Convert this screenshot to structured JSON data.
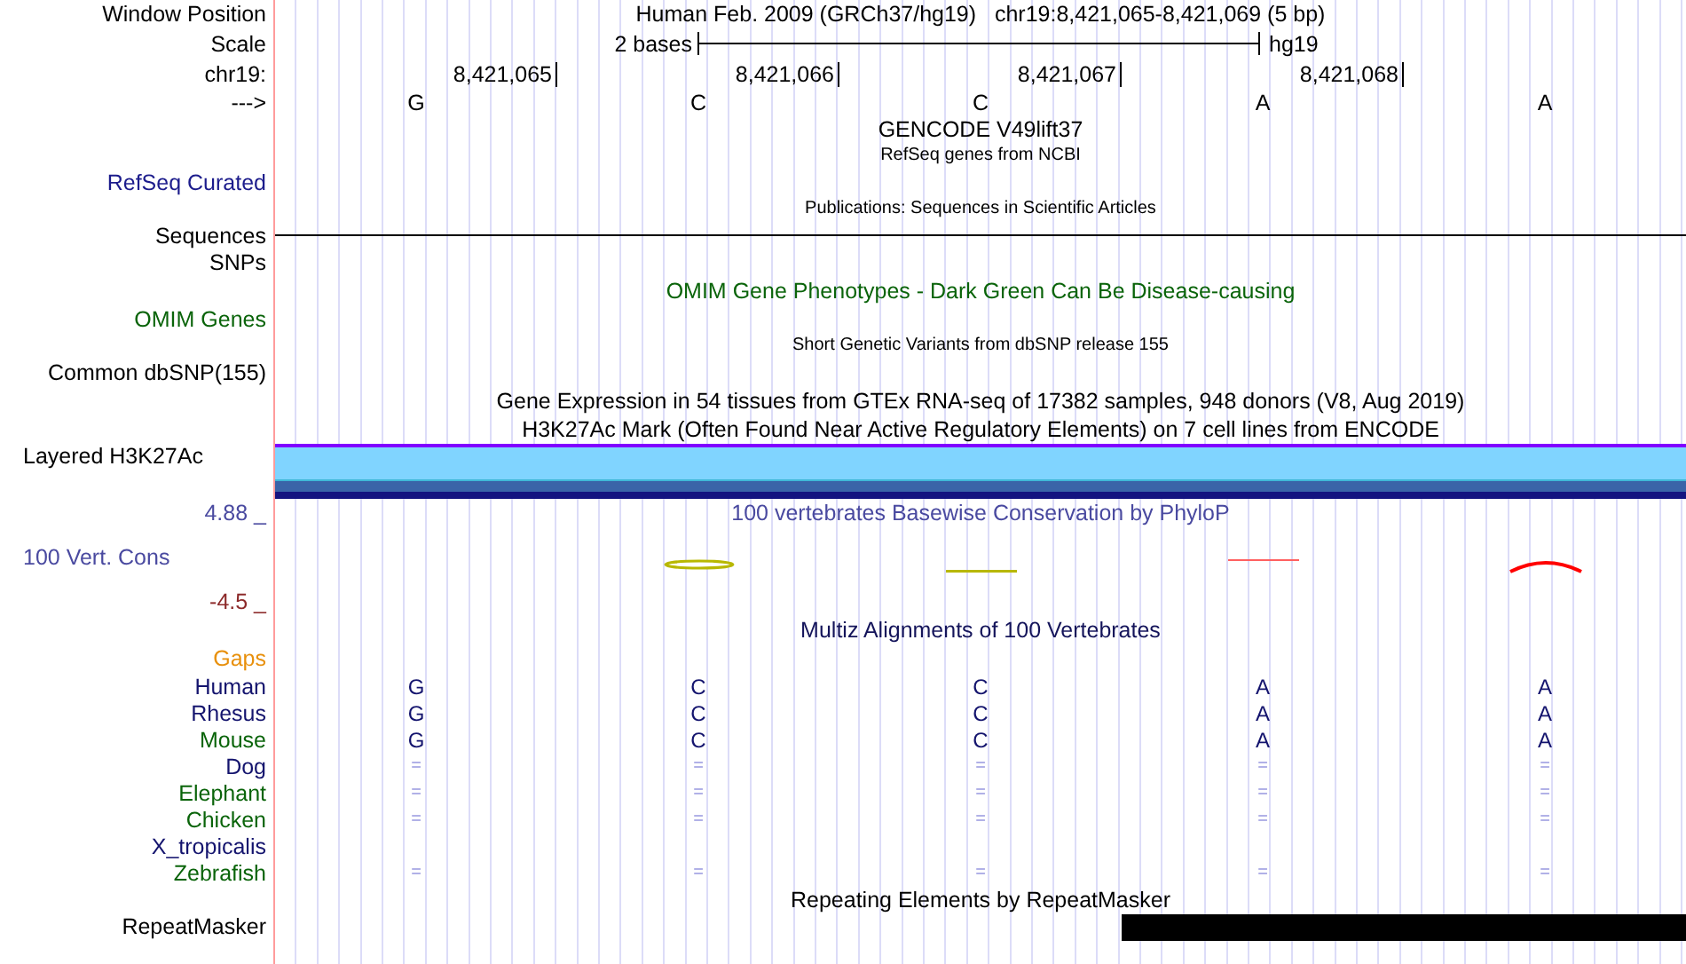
{
  "rows": [
    {
      "kind": "position",
      "label": "Window Position",
      "text": "Human Feb. 2009 (GRCh37/hg19)   chr19:8,421,065-8,421,069 (5 bp)"
    },
    {
      "kind": "scale",
      "label": "Scale",
      "text": "2 bases",
      "assembly": "hg19"
    },
    {
      "kind": "coordinates",
      "label": "chr19:",
      "values": [
        "8,421,065",
        "8,421,066",
        "8,421,067",
        "8,421,068"
      ]
    },
    {
      "kind": "bases",
      "label": "--->",
      "values": [
        "G",
        "C",
        "C",
        "A",
        "A"
      ]
    },
    {
      "kind": "title",
      "title": "GENCODE V49lift37",
      "color": "#000000"
    },
    {
      "kind": "subtitle",
      "title": "RefSeq genes from NCBI"
    },
    {
      "kind": "label",
      "label": "RefSeq Curated",
      "color": "#1c1c8c"
    },
    {
      "kind": "subtitle",
      "title": "Publications: Sequences in Scientific Articles"
    },
    {
      "kind": "line",
      "label": "Sequences",
      "color": "#000000"
    },
    {
      "kind": "label",
      "label": "SNPs",
      "color": "#000000"
    },
    {
      "kind": "title",
      "title": "OMIM Gene Phenotypes - Dark Green Can Be Disease-causing",
      "color": "#0a640a"
    },
    {
      "kind": "label",
      "label": "OMIM Genes",
      "color": "#0a640a"
    },
    {
      "kind": "subtitle",
      "title": "Short Genetic Variants from dbSNP release 155"
    },
    {
      "kind": "label",
      "label": "Common dbSNP(155)",
      "color": "#000000"
    },
    {
      "kind": "title",
      "title": "Gene Expression in 54 tissues from GTEx RNA-seq of 17382 samples, 948 donors (V8, Aug 2019)",
      "color": "#000000"
    },
    {
      "kind": "title",
      "title": "H3K27Ac Mark (Often Found Near Active Regulatory Elements) on 7 cell lines from ENCODE",
      "color": "#000000"
    },
    {
      "kind": "bar",
      "label": "Layered H3K27Ac"
    },
    {
      "kind": "axis",
      "label": "4.88 _",
      "color": "#4a4aa0",
      "title": "100 vertebrates Basewise Conservation by PhyloP"
    },
    {
      "kind": "wiggle",
      "label": "100 Vert. Cons",
      "color": "#4a4aa0"
    },
    {
      "kind": "axis",
      "label": "-4.5 _",
      "color": "#8c2a2a"
    },
    {
      "kind": "title",
      "title": "Multiz Alignments of 100 Vertebrates",
      "color": "#14145a"
    },
    {
      "kind": "label",
      "label": "Gaps",
      "color": "#e8900c"
    },
    {
      "kind": "species",
      "label": "Human",
      "color": "#14146e",
      "aligned": true,
      "values": [
        "G",
        "C",
        "C",
        "A",
        "A"
      ]
    },
    {
      "kind": "species",
      "label": "Rhesus",
      "color": "#14146e",
      "aligned": true,
      "values": [
        "G",
        "C",
        "C",
        "A",
        "A"
      ]
    },
    {
      "kind": "species",
      "label": "Mouse",
      "color": "#0a640a",
      "aligned": true,
      "values": [
        "G",
        "C",
        "C",
        "A",
        "A"
      ]
    },
    {
      "kind": "species",
      "label": "Dog",
      "color": "#14146e",
      "aligned": false,
      "values": [
        "=",
        "=",
        "=",
        "=",
        "="
      ]
    },
    {
      "kind": "species",
      "label": "Elephant",
      "color": "#0a640a",
      "aligned": false,
      "values": [
        "=",
        "=",
        "=",
        "=",
        "="
      ]
    },
    {
      "kind": "species",
      "label": "Chicken",
      "color": "#0a640a",
      "aligned": false,
      "values": [
        "=",
        "=",
        "=",
        "=",
        "="
      ]
    },
    {
      "kind": "species",
      "label": "X_tropicalis",
      "color": "#14146e"
    },
    {
      "kind": "species",
      "label": "Zebrafish",
      "color": "#0a640a",
      "aligned": false,
      "values": [
        "=",
        "=",
        "=",
        "=",
        "="
      ]
    },
    {
      "kind": "title",
      "title": "Repeating Elements by RepeatMasker",
      "color": "#000000"
    },
    {
      "kind": "repeat",
      "label": "RepeatMasker",
      "color": "#000000"
    }
  ]
}
